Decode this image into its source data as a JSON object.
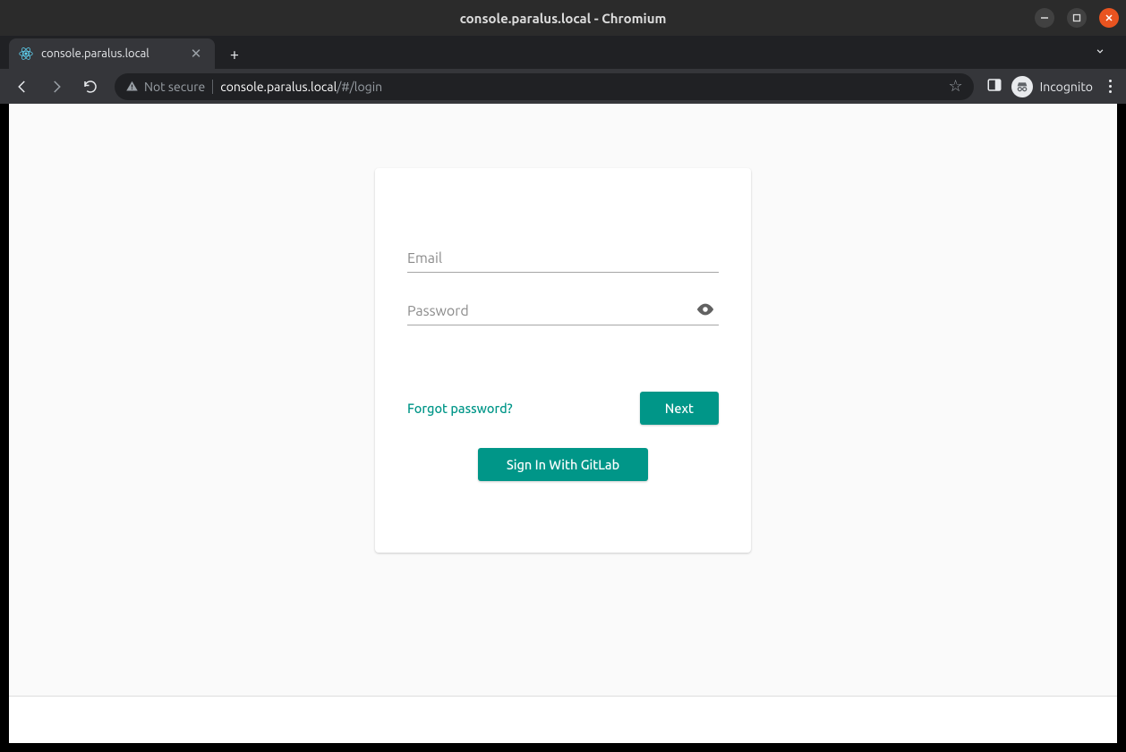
{
  "window": {
    "title": "console.paralus.local - Chromium"
  },
  "tab": {
    "title": "console.paralus.local"
  },
  "address": {
    "not_secure": "Not secure",
    "host": "console.paralus.local",
    "path": "/#/login"
  },
  "browser": {
    "incognito_label": "Incognito"
  },
  "login": {
    "email_placeholder": "Email",
    "password_placeholder": "Password",
    "forgot": "Forgot password?",
    "next": "Next",
    "sso": "Sign In With GitLab"
  },
  "colors": {
    "accent": "#009688"
  }
}
